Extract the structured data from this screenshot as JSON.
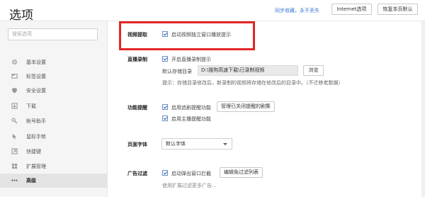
{
  "header": {
    "title": "选项",
    "sync_link": "同步收藏，永不丢失",
    "internet_btn": "Internet选项",
    "restore_btn": "恢复本页默认"
  },
  "sidebar": {
    "search_placeholder": "搜索选项",
    "items": [
      {
        "label": "基本设置",
        "icon": "gear-icon"
      },
      {
        "label": "标签设置",
        "icon": "tab-icon"
      },
      {
        "label": "安全设置",
        "icon": "shield-icon"
      },
      {
        "label": "下载",
        "icon": "download-icon"
      },
      {
        "label": "帐号助手",
        "icon": "key-icon"
      },
      {
        "label": "鼠标手势",
        "icon": "mouse-icon"
      },
      {
        "label": "快捷键",
        "icon": "shortcut-icon"
      },
      {
        "label": "扩展管理",
        "icon": "extension-icon"
      },
      {
        "label": "高级",
        "icon": "more-icon",
        "active": true
      }
    ]
  },
  "main": {
    "video": {
      "label": "视频提取",
      "option": "启动视频独立窗口播放提示"
    },
    "live": {
      "label": "直播录制",
      "option": "开启直播录制提示",
      "dir_label": "默认存储目录",
      "dir_value": "D:\\搜狗高速下载\\已录制视频",
      "browse_btn": "浏览",
      "hint": "提示：存储目录修改后，新录制的视频将存储在修改后的目录中。（不迁移老数据）"
    },
    "reminder": {
      "label": "功能提醒",
      "option1": "启用追剧提醒功能",
      "manage_btn": "管理已关闭提醒的剧集",
      "option2": "启用主播提醒功能"
    },
    "font": {
      "label": "页面字体",
      "selected": "默认字体"
    },
    "adfilter": {
      "label": "广告过滤",
      "option": "启动弹出窗口拦截",
      "edit_btn": "编辑免过滤列表",
      "hint": "使用扩展过滤更多广告..."
    }
  },
  "colors": {
    "highlight_box": "#e32626",
    "link": "#3a7bd5",
    "sidebar_bg": "#f5f5f5"
  }
}
